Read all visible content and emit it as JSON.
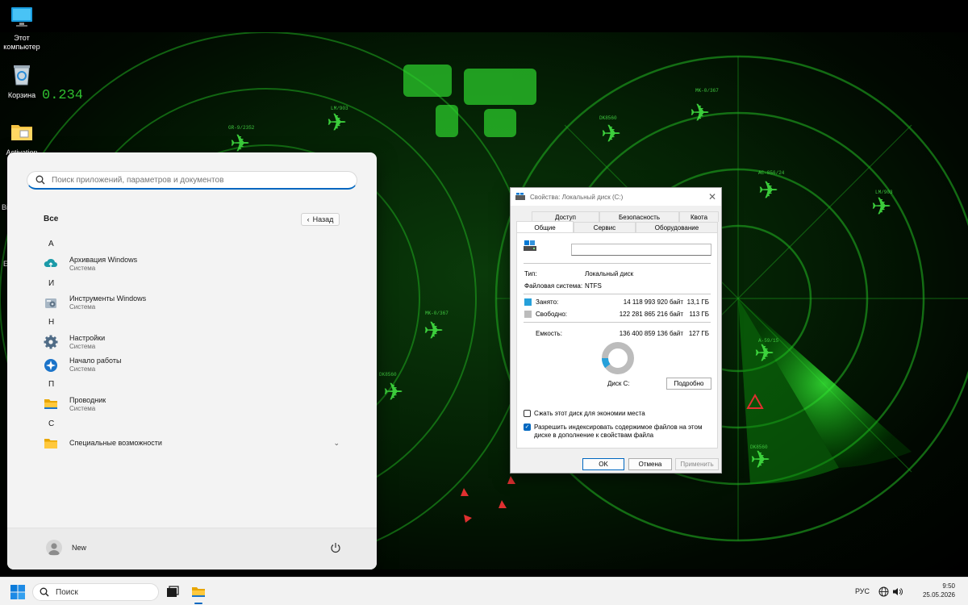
{
  "desktop": {
    "icons": [
      {
        "label": "Этот компьютер"
      },
      {
        "label": "Корзина"
      },
      {
        "label": "Activation"
      }
    ],
    "partial_labels": [
      "Bi",
      "E"
    ],
    "wallpaper_texts": {
      "counter": "0.234",
      "flight_codes": [
        "LM/903",
        "GR-9/2352",
        "MK-0/367",
        "DK8560",
        "AC-856/24",
        "LM/903",
        "MK-0/367",
        "DK8560",
        "A-59/15",
        "DK8560"
      ]
    }
  },
  "start_menu": {
    "search_placeholder": "Поиск приложений, параметров и документов",
    "all_label": "Все",
    "back_label": "Назад",
    "groups": [
      {
        "letter": "А",
        "apps": [
          {
            "name": "Архивация Windows",
            "sub": "Система",
            "icon": "cloud-backup-icon"
          }
        ]
      },
      {
        "letter": "И",
        "apps": [
          {
            "name": "Инструменты Windows",
            "sub": "Система",
            "icon": "windows-tools-icon"
          }
        ]
      },
      {
        "letter": "Н",
        "apps": [
          {
            "name": "Настройки",
            "sub": "Система",
            "icon": "settings-gear-icon"
          },
          {
            "name": "Начало работы",
            "sub": "Система",
            "icon": "get-started-icon"
          }
        ]
      },
      {
        "letter": "П",
        "apps": [
          {
            "name": "Проводник",
            "sub": "Система",
            "icon": "file-explorer-icon"
          }
        ]
      },
      {
        "letter": "С",
        "apps": [
          {
            "name": "Специальные возможности",
            "sub": "",
            "icon": "folder-icon",
            "expandable": true
          }
        ]
      }
    ],
    "user_name": "New"
  },
  "dialog": {
    "title": "Свойства: Локальный диск (C:)",
    "tabs_row1": [
      "Доступ",
      "Безопасность",
      "Квота"
    ],
    "tabs_row2": [
      "Общие",
      "Сервис",
      "Оборудование"
    ],
    "active_tab": "Общие",
    "drive_name_value": "",
    "type_label": "Тип:",
    "type_value": "Локальный диск",
    "fs_label": "Файловая система:",
    "fs_value": "NTFS",
    "used_label": "Занято:",
    "used_bytes": "14 118 993 920 байт",
    "used_size": "13,1 ГБ",
    "free_label": "Свободно:",
    "free_bytes": "122 281 865 216 байт",
    "free_size": "113 ГБ",
    "capacity_label": "Емкость:",
    "capacity_bytes": "136 400 859 136 байт",
    "capacity_size": "127 ГБ",
    "used_fraction": 0.1035,
    "used_color": "#26a0da",
    "free_color": "#bcbcbc",
    "disk_label": "Диск C:",
    "details_button": "Подробно",
    "compress_label": "Сжать этот диск для экономии места",
    "compress_checked": false,
    "index_label_line1": "Разрешить индексировать содержимое файлов на этом",
    "index_label_line2": "диске в дополнение к свойствам файла",
    "index_checked": true,
    "ok_button": "OK",
    "cancel_button": "Отмена",
    "apply_button": "Применить"
  },
  "taskbar": {
    "search_label": "Поиск",
    "language": "РУС",
    "time": "9:50",
    "date": "25.05.2026",
    "accent": "#0067c0"
  }
}
